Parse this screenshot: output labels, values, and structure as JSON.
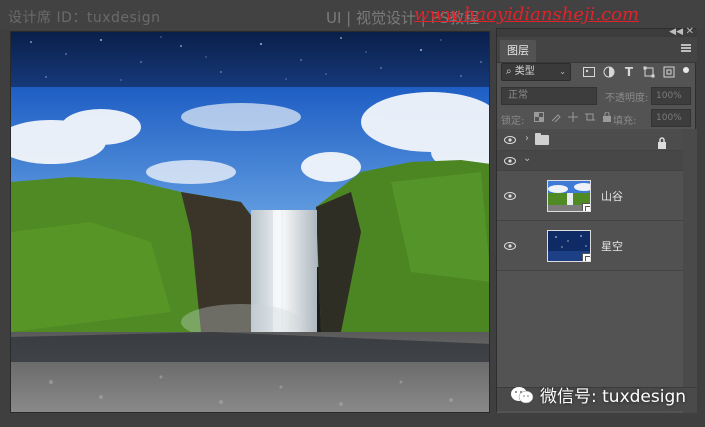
{
  "watermarks": {
    "left": "设计席 ID：tuxdesign",
    "right": "UI | 视觉设计 | PS教程",
    "url": "www.haoyidiansheji.com",
    "bottom": "微信号: tuxdesign"
  },
  "colors": {
    "accent_url": "#e0232b",
    "panel_bg": "#535353",
    "app_bg": "#3f3f3f"
  },
  "layers_panel": {
    "tab_label": "图层",
    "filter": {
      "kind_label": "类型",
      "icons": [
        "image-filter-icon",
        "adjustment-filter-icon",
        "type-filter-icon",
        "shape-filter-icon",
        "smart-object-filter-icon"
      ]
    },
    "blend_mode": "正常",
    "opacity_label": "不透明度:",
    "opacity_value": "100%",
    "lock_label": "锁定:",
    "fill_label": "填充:",
    "fill_value": "100%",
    "layers": [
      {
        "kind": "group",
        "name": "",
        "visible": true,
        "locked": true,
        "collapsed": true
      },
      {
        "kind": "group-expanded",
        "name": "",
        "visible": true
      },
      {
        "kind": "smart-object",
        "name": "山谷",
        "visible": true,
        "thumbnail": "waterfall-thumbnail"
      },
      {
        "kind": "smart-object",
        "name": "星空",
        "visible": true,
        "thumbnail": "starry-sky-thumbnail"
      }
    ]
  }
}
